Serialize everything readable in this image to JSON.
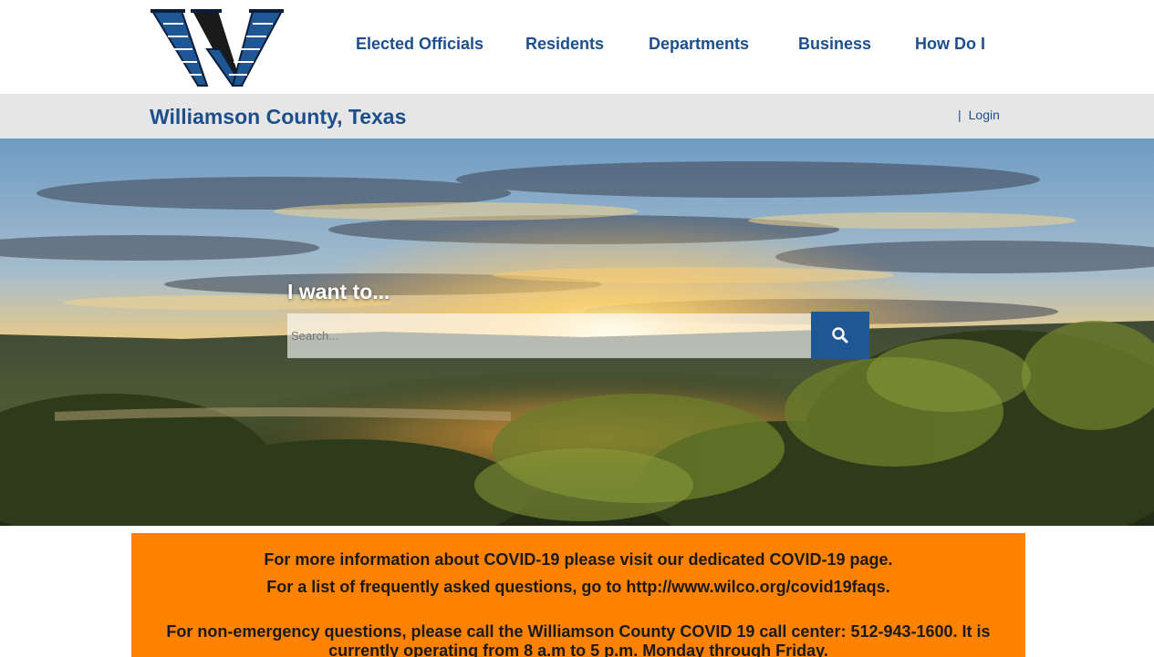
{
  "header": {
    "logo_alt": "Williamson County W logo",
    "nav": [
      {
        "label": "Elected Officials"
      },
      {
        "label": "Residents"
      },
      {
        "label": "Departments"
      },
      {
        "label": "Business"
      },
      {
        "label": "How Do I"
      }
    ]
  },
  "titlebar": {
    "site_title": "Williamson County, Texas",
    "separator": "|",
    "login_label": "Login"
  },
  "hero": {
    "heading": "I want to...",
    "search_placeholder": "Search...",
    "search_icon": "search-icon"
  },
  "alert": {
    "lines": [
      "For more information about COVID-19 please visit our dedicated COVID-19 page.",
      "For a list of frequently asked questions, go to http://www.wilco.org/covid19faqs.",
      "For non-emergency questions, please call the Williamson County COVID 19 call center: 512-943-1600. It is",
      "currently operating from 8 a.m to 5 p.m. Monday through Friday."
    ]
  },
  "colors": {
    "brand_blue": "#1d4f8c",
    "button_blue": "#1f5694",
    "alert_orange": "#ff8200",
    "titlebar_gray": "#e6e6e6"
  }
}
